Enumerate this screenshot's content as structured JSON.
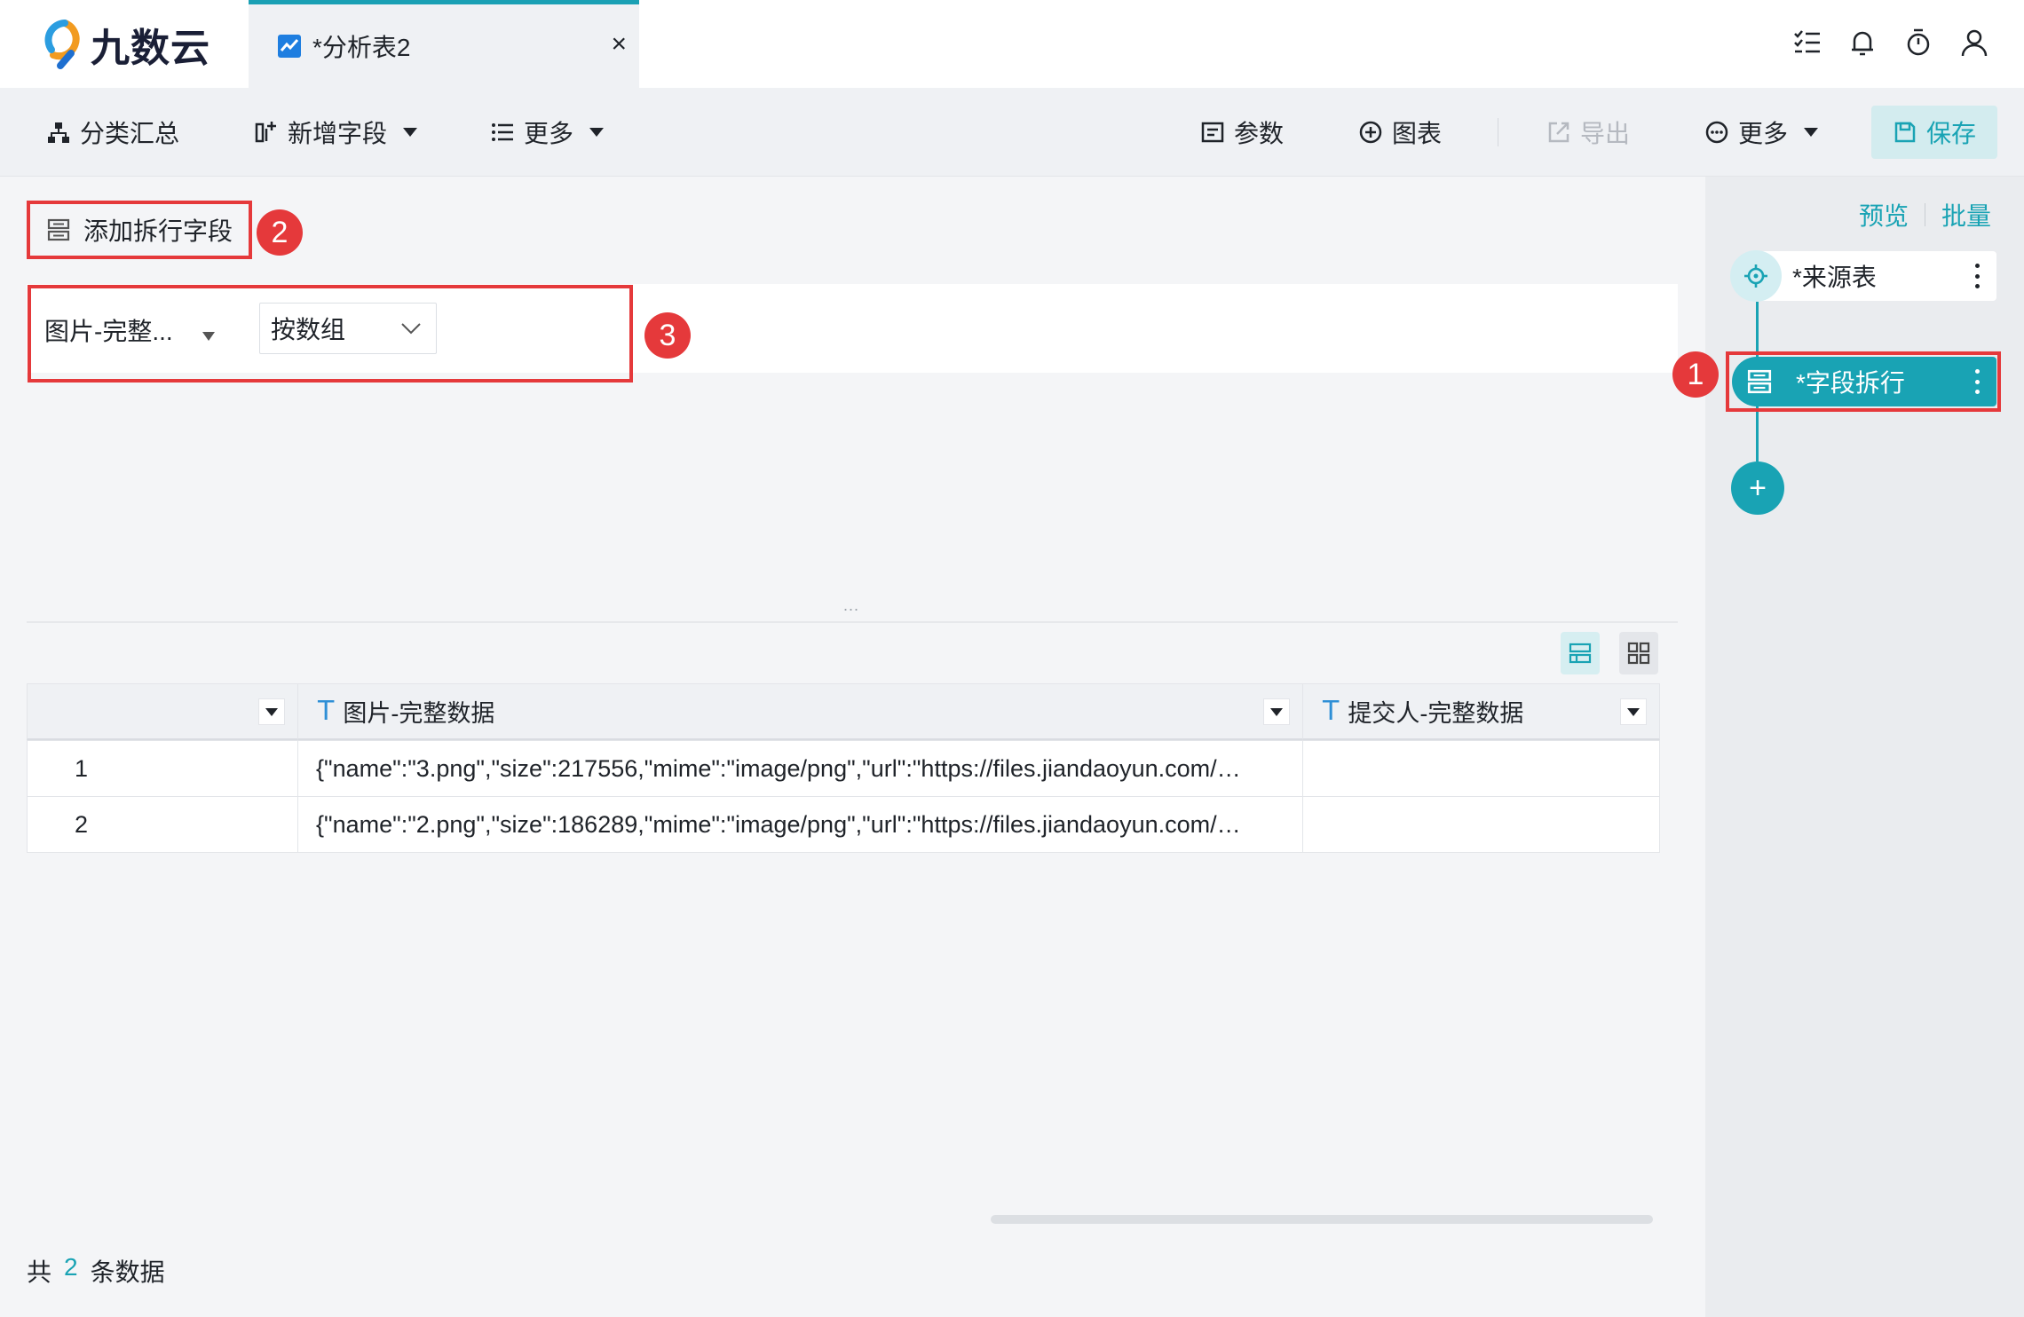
{
  "app": {
    "logo_text": "九数云"
  },
  "tab": {
    "title": "*分析表2",
    "close": "×"
  },
  "toolbar": {
    "group_summary": "分类汇总",
    "add_field": "新增字段",
    "more_left": "更多",
    "params": "参数",
    "chart": "图表",
    "export": "导出",
    "more_right": "更多",
    "save": "保存"
  },
  "split": {
    "add_button": "添加拆行字段",
    "field": "图片-完整...",
    "mode": "按数组"
  },
  "badges": {
    "one": "1",
    "two": "2",
    "three": "3"
  },
  "splitter_dots": "...",
  "table": {
    "columns": [
      {
        "label": "",
        "type_icon": ""
      },
      {
        "label": "图片-完整数据",
        "type_icon": "T"
      },
      {
        "label": "提交人-完整数据",
        "type_icon": "T"
      }
    ],
    "rows": [
      {
        "index": "1",
        "image": "{\"name\":\"3.png\",\"size\":217556,\"mime\":\"image/png\",\"url\":\"https://files.jiandaoyun.com/…",
        "submitter": ""
      },
      {
        "index": "2",
        "image": "{\"name\":\"2.png\",\"size\":186289,\"mime\":\"image/png\",\"url\":\"https://files.jiandaoyun.com/…",
        "submitter": ""
      }
    ]
  },
  "footer": {
    "prefix": "共",
    "count": "2",
    "suffix": "条数据"
  },
  "panel": {
    "preview": "预览",
    "batch": "批量",
    "nodes": [
      {
        "label": "*来源表"
      },
      {
        "label": "*字段拆行"
      }
    ],
    "add": "+"
  },
  "colors": {
    "accent": "#19a3b4",
    "highlight": "#e5393b"
  }
}
